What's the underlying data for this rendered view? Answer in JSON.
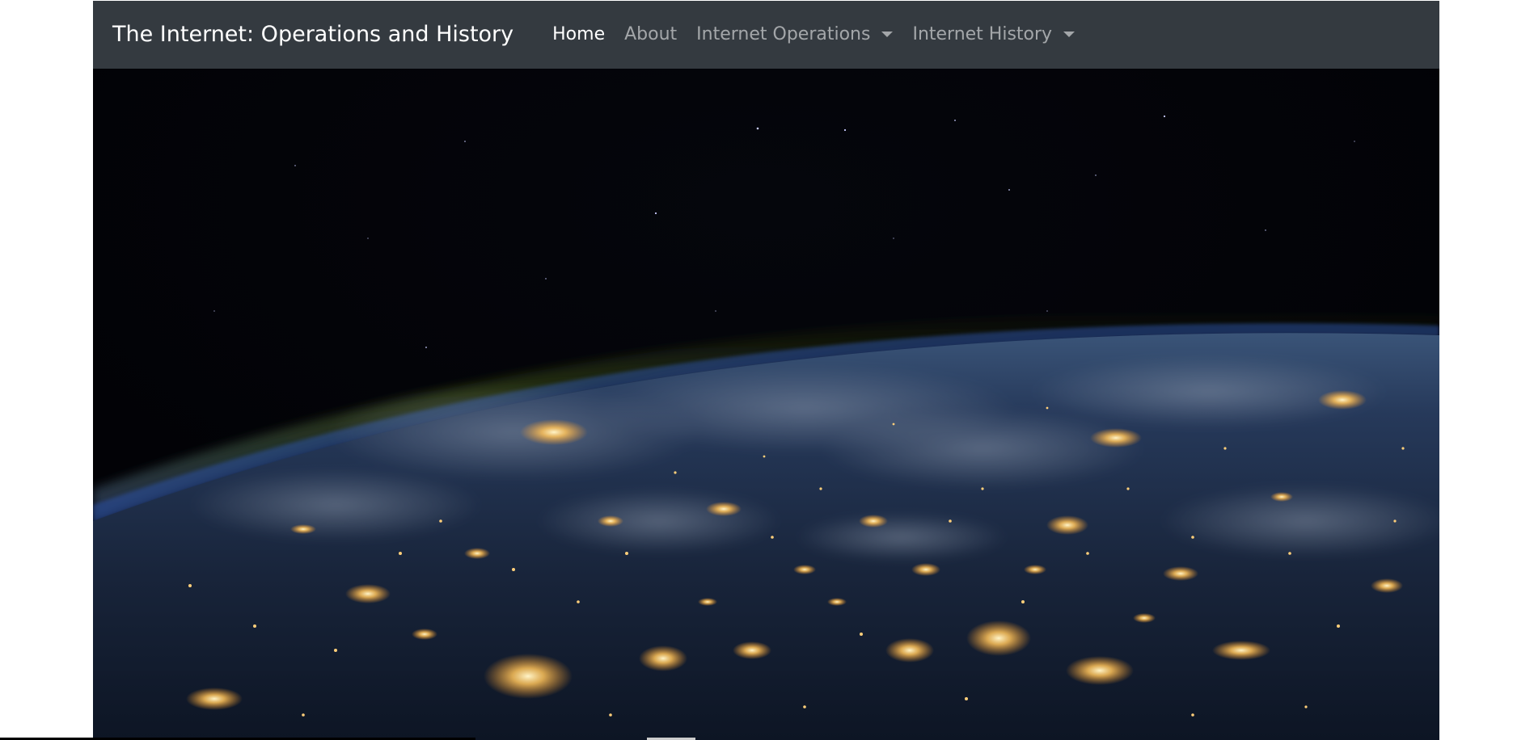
{
  "navbar": {
    "brand": "The Internet: Operations and History",
    "items": [
      {
        "label": "Home",
        "active": true,
        "dropdown": false
      },
      {
        "label": "About",
        "active": false,
        "dropdown": false
      },
      {
        "label": "Internet Operations",
        "active": false,
        "dropdown": true
      },
      {
        "label": "Internet History",
        "active": false,
        "dropdown": true
      }
    ],
    "background_color": "#343a40"
  },
  "hero": {
    "image_subject": "earth-at-night-from-space"
  },
  "icons": {
    "dropdown": "chevron-down-icon"
  }
}
